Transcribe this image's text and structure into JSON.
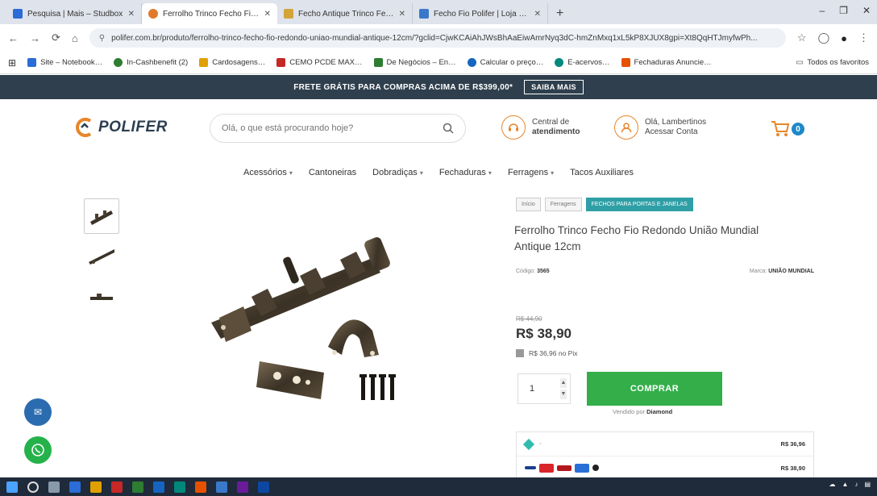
{
  "browser": {
    "tabs": [
      {
        "title": "Pesquisa | Mais – Studbox",
        "color": "#2b6cd6",
        "active": false
      },
      {
        "title": "Ferrolho Trinco Fecho Fio Red...",
        "color": "#e07a2a",
        "active": true
      },
      {
        "title": "Fecho Antique Trinco Fecho...",
        "color": "#d3a43a",
        "active": false
      },
      {
        "title": "Fecho Fio Polifer | Loja Online",
        "color": "#3a78c9",
        "active": false
      }
    ],
    "new_tab": "+",
    "window_controls": [
      "–",
      "❐",
      "✕"
    ],
    "url": "polifer.com.br/produto/ferrolho-trinco-fecho-fio-redondo-uniao-mundial-antique-12cm/?gclid=CjwKCAiAhJWsBhAaEiwAmrNyq3dC-hmZnMxq1xL5kP8XJUX8gpi=Xt8QqHTJmyfwPh...",
    "bookmarks": [
      {
        "label": "Site – Notebook…",
        "color": "#2b6cd6"
      },
      {
        "label": "In-Cashbenefit (2)",
        "color": "#2e7d32"
      },
      {
        "label": "Cardosagens…",
        "color": "#e0a100"
      },
      {
        "label": "CEMO PCDE MAX…",
        "color": "#c62828"
      },
      {
        "label": "De Negócios – En…",
        "color": "#2e7d32"
      },
      {
        "label": "Calcular o preço…",
        "color": "#1565c0"
      },
      {
        "label": "E-acervos…",
        "color": "#00897b"
      },
      {
        "label": "Fechaduras Anuncie…",
        "color": "#e65100"
      }
    ],
    "bookmarks_other": "Todos os favoritos"
  },
  "promo": {
    "text": "FRETE GRÁTIS PARA COMPRAS ACIMA DE R$399,00*",
    "button": "SAIBA MAIS"
  },
  "header": {
    "logo": "POLIFER",
    "search_placeholder": "Olá, o que está procurando hoje?",
    "service_line1": "Central de",
    "service_line2": "atendimento",
    "account_line1": "Olá, Lambertinos",
    "account_line2": "Acessar Conta",
    "cart_count": "0"
  },
  "nav": [
    {
      "label": "Acessórios",
      "caret": true
    },
    {
      "label": "Cantoneiras",
      "caret": false
    },
    {
      "label": "Dobradiças",
      "caret": true
    },
    {
      "label": "Fechaduras",
      "caret": true
    },
    {
      "label": "Ferragens",
      "caret": true
    },
    {
      "label": "Tacos Auxiliares",
      "caret": false
    }
  ],
  "product": {
    "tags": [
      "Início",
      "Ferragens",
      "FECHOS PARA PORTAS E JANELAS"
    ],
    "title": "Ferrolho Trinco Fecho Fio Redondo União Mundial Antique 12cm",
    "sku_label": "Código:",
    "sku": "3565",
    "brand_label": "Marca:",
    "brand": "UNIÃO MUNDIAL",
    "old_price": "R$ 44,90",
    "price": "R$ 38,90",
    "pix_text": "R$ 36,96 no Pix",
    "qty": "1",
    "buy_label": "COMPRAR",
    "seller_label": "Vendido por",
    "seller": "Diamond",
    "payments": [
      {
        "label_price": "R$ 36,96"
      },
      {
        "label_price": "R$ 38,90"
      }
    ]
  },
  "colors": {
    "promo_bg": "#2f3f4d",
    "buy_green": "#33ae49",
    "tag_teal": "#2f9fa6",
    "service_orange": "#e8862a",
    "cart_blue": "#1e88c8",
    "chat_blue": "#2b6cb0",
    "whatsapp_green": "#25b24a"
  }
}
